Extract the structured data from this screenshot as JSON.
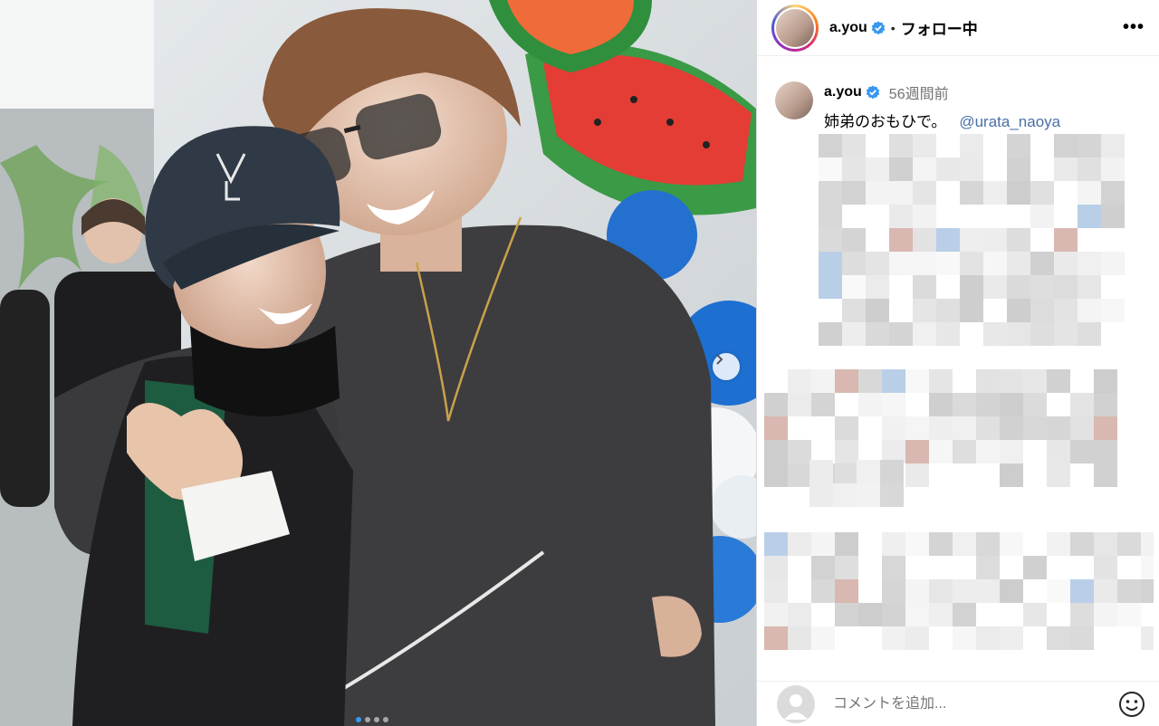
{
  "post": {
    "username": "a.you",
    "follow_status": "フォロー中",
    "separator": "•",
    "more_label": "•••"
  },
  "caption": {
    "username": "a.you",
    "timestamp": "56週間前",
    "text": "姉弟のおもひで。",
    "mention": "@urata_naoya"
  },
  "comment": {
    "placeholder": "コメントを追加..."
  },
  "colors": {
    "verified": "#3897f0",
    "mention": "#4a6fa5"
  }
}
